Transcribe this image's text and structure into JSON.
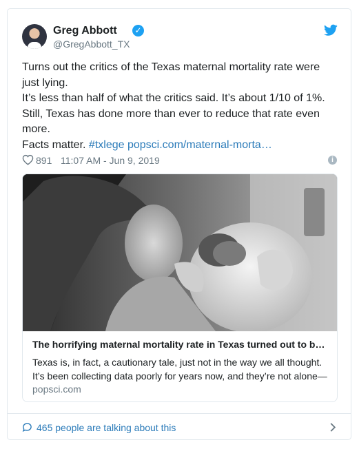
{
  "author": {
    "name": "Greg Abbott",
    "handle": "@GregAbbott_TX",
    "verified_icon": "verified-badge-icon"
  },
  "tweet": {
    "line1": "Turns out the critics of the Texas maternal mortality rate were just lying.",
    "line2": "It’s less than half of what the critics said. It’s about 1/10 of 1%.",
    "line3": "Still, Texas has done more than ever to reduce that rate even more.",
    "line4_prefix": "Facts matter.",
    "hashtag": "#txlege",
    "url": "popsci.com/maternal-morta…"
  },
  "meta": {
    "likes": "891",
    "timestamp": "11:07 AM - Jun 9, 2019"
  },
  "link_card": {
    "title": "The horrifying maternal mortality rate in Texas turned out to b…",
    "description": "Texas is, in fact, a cautionary tale, just not in the way we all thought. It’s been collecting data poorly for years now, and they’re not alone—",
    "domain": "popsci.com"
  },
  "footer": {
    "talking": "465 people are talking about this"
  },
  "colors": {
    "link": "#2b7bb9",
    "verified": "#1da1f2",
    "muted": "#697882"
  }
}
